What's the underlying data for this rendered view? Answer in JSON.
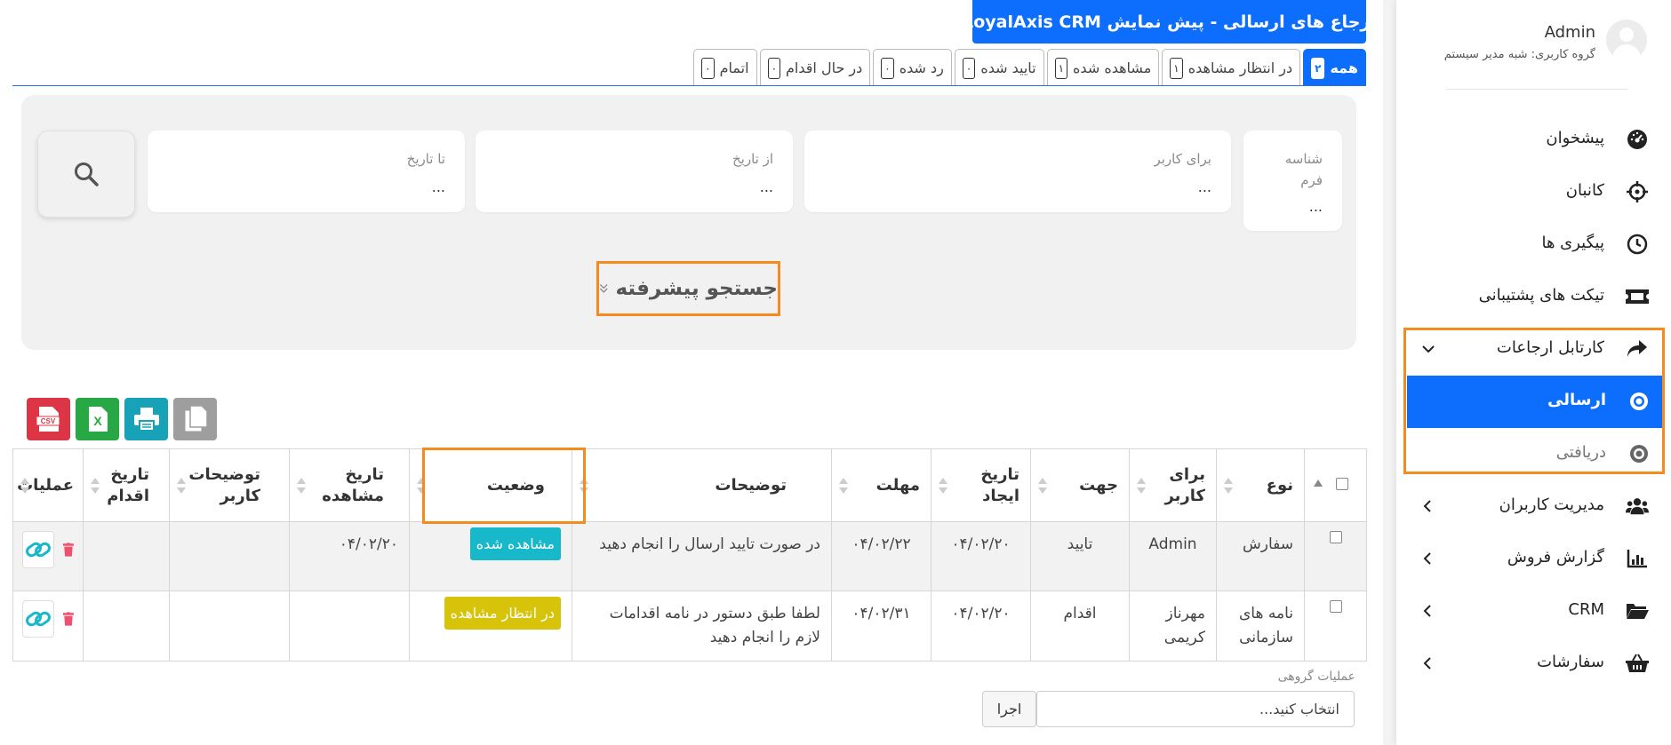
{
  "page": {
    "title": "ارجاع های ارسالی - پیش نمایش LoyalAxis CRM"
  },
  "tabs": [
    {
      "label": "همه",
      "count": "۲",
      "active": true
    },
    {
      "label": "در انتظار مشاهده",
      "count": "۱"
    },
    {
      "label": "مشاهده شده",
      "count": "۱"
    },
    {
      "label": "تایید شده",
      "count": "۰"
    },
    {
      "label": "رد شده",
      "count": "۰"
    },
    {
      "label": "در حال اقدام",
      "count": "۰"
    },
    {
      "label": "اتمام",
      "count": "۰"
    }
  ],
  "filters": {
    "form_id": {
      "label": "شناسه فرم",
      "value": "..."
    },
    "for_user": {
      "label": "برای کاربر",
      "value": "..."
    },
    "from_date": {
      "label": "از تاریخ",
      "value": "..."
    },
    "to_date": {
      "label": "تا تاریخ",
      "value": "..."
    },
    "advanced_search": "جستجو پیشرفته"
  },
  "export_buttons": [
    {
      "name": "copy",
      "color": "#9e9e9e"
    },
    {
      "name": "print",
      "color": "#17a2b8"
    },
    {
      "name": "excel",
      "color": "#28a745",
      "text": "X"
    },
    {
      "name": "csv",
      "color": "#dc3545",
      "text": "CSV"
    }
  ],
  "table": {
    "headers": {
      "type": "نوع",
      "for_user": "برای کاربر",
      "direction": "جهت",
      "created": "تاریخ ایجاد",
      "deadline": "مهلت",
      "description": "توضیحات",
      "status": "وضعیت",
      "viewed": "تاریخ مشاهده",
      "user_notes": "توضیحات کاربر",
      "action_date": "تاریخ اقدام",
      "operations": "عملیات"
    },
    "rows": [
      {
        "type": "سفارش",
        "for_user": "Admin",
        "direction": "تایید",
        "created": "۰۴/۰۲/۲۰",
        "deadline": "۰۴/۰۲/۲۲",
        "description": "در صورت تایید ارسال را انجام دهید",
        "status": "مشاهده شده",
        "viewed": "۰۴/۰۲/۲۰",
        "user_notes": "",
        "action_date": ""
      },
      {
        "type": "نامه های سازمانی",
        "for_user": "مهرناز کریمی",
        "direction": "اقدام",
        "created": "۰۴/۰۲/۲۰",
        "deadline": "۰۴/۰۲/۳۱",
        "description": "لطفا طبق دستور در نامه اقدامات لازم را انجام دهید",
        "status": "در انتظار مشاهده",
        "viewed": "",
        "user_notes": "",
        "action_date": ""
      }
    ]
  },
  "group_ops": {
    "label": "عملیات گروهی",
    "select_placeholder": "انتخاب کنید...",
    "run": "اجرا"
  },
  "sidebar": {
    "user_name": "Admin",
    "user_group": "گروه کاربری: شبه مدیر سیستم",
    "items": [
      {
        "label": "پیشخوان",
        "icon": "dashboard-icon"
      },
      {
        "label": "کانبان",
        "icon": "crosshair-icon"
      },
      {
        "label": "پیگیری ها",
        "icon": "clock-icon"
      },
      {
        "label": "تیکت های پشتیبانی",
        "icon": "ticket-icon"
      },
      {
        "label": "کارتابل ارجاعات",
        "icon": "share-icon",
        "expanded": true
      },
      {
        "label": "ارسالی",
        "icon": "radio-icon",
        "active": true
      },
      {
        "label": "دریافتی",
        "icon": "radio-icon"
      },
      {
        "label": "مدیریت کاربران",
        "icon": "users-icon"
      },
      {
        "label": "گزارش فروش",
        "icon": "chart-icon"
      },
      {
        "label": "CRM",
        "icon": "folder-icon"
      },
      {
        "label": "سفارشات",
        "icon": "basket-icon"
      }
    ]
  },
  "colors": {
    "primary": "#0d6efd",
    "highlight": "#f58a1f",
    "status_seen": "#17b8c9",
    "status_waiting": "#d8c30b",
    "delete": "#f0506e"
  }
}
